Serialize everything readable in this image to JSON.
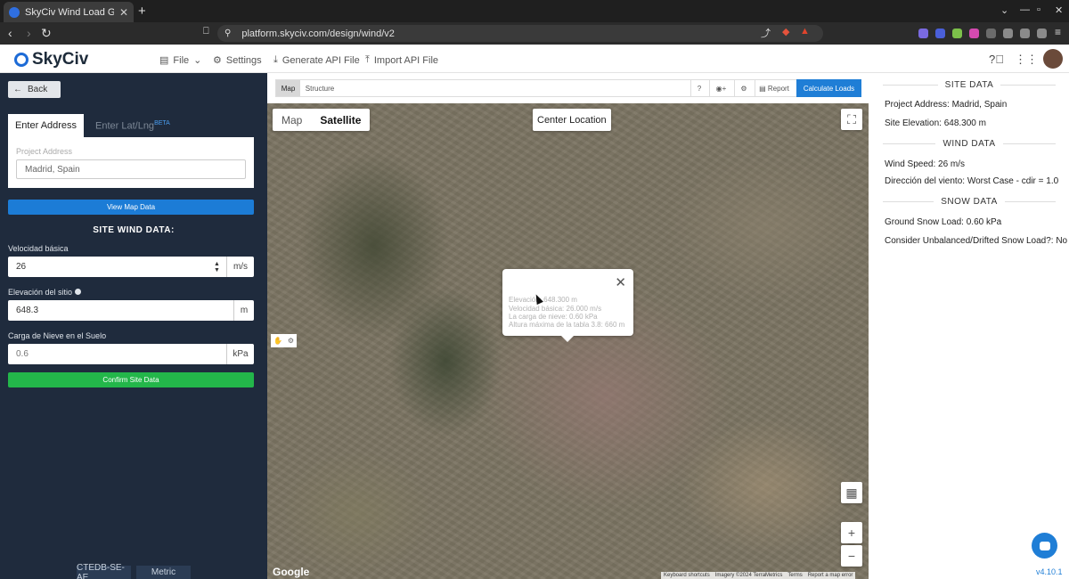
{
  "browser": {
    "tab_title": "SkyCiv Wind Load Generato",
    "url": "platform.skyciv.com/design/wind/v2"
  },
  "header": {
    "brand": "SkyCiv",
    "menu": {
      "file": "File",
      "settings": "Settings",
      "generate_api": "Generate API File",
      "import_api": "Import API File"
    }
  },
  "left": {
    "back": "Back",
    "tab_address": "Enter Address",
    "tab_latlng": "Enter Lat/Lng",
    "tab_latlng_badge": "BETA",
    "address_label": "Project Address",
    "address_value": "Madrid, Spain",
    "view_map_button": "View Map Data",
    "section_title": "SITE WIND DATA:",
    "wind_label": "Velocidad básica",
    "wind_value": "26",
    "wind_unit": "m/s",
    "elev_label": "Elevación del sitio",
    "elev_value": "648.3",
    "elev_unit": "m",
    "snow_label": "Carga de Nieve en el Suelo",
    "snow_value": "0.6",
    "snow_unit": "kPa",
    "confirm_button": "Confirm Site Data",
    "code": "CTEDB-SE-AE",
    "units": "Metric"
  },
  "toolbar": {
    "map": "Map",
    "structure": "Structure",
    "help": "?",
    "report": "Report",
    "calculate": "Calculate Loads"
  },
  "map": {
    "type_map": "Map",
    "type_satellite": "Satellite",
    "center_location": "Center Location",
    "google": "Google",
    "attribution": [
      "Keyboard shortcuts",
      "Imagery ©2024 TerraMetrics",
      "Terms",
      "Report a map error"
    ],
    "popup": {
      "elevation": "Elevación: 648.300 m",
      "wind": "Velocidad básica: 26.000 m/s",
      "snow": "La carga de nieve: 0.60 kPa",
      "table": "Altura máxima de la tabla 3.8: 660 m"
    }
  },
  "right": {
    "site_heading": "SITE DATA",
    "project_address": "Project Address: Madrid, Spain",
    "site_elevation": "Site Elevation: 648.300 m",
    "wind_heading": "WIND DATA",
    "wind_speed": "Wind Speed: 26 m/s",
    "wind_dir": "Dirección del viento: Worst Case - cdir = 1.0",
    "snow_heading": "SNOW DATA",
    "ground_snow": "Ground Snow Load: 0.60 kPa",
    "drift_snow": "Consider Unbalanced/Drifted Snow Load?: No",
    "version": "v4.10.1"
  },
  "colors": {
    "accent": "#1f7ed6",
    "confirm": "#23b64a",
    "sidebar": "#1f2b3d"
  },
  "icons": [
    "back-arrow-icon",
    "file-icon",
    "gear-icon",
    "download-icon",
    "help-icon",
    "apps-grid-icon",
    "fullscreen-icon",
    "zoom-in-icon",
    "zoom-out-icon",
    "close-icon",
    "chat-icon"
  ]
}
